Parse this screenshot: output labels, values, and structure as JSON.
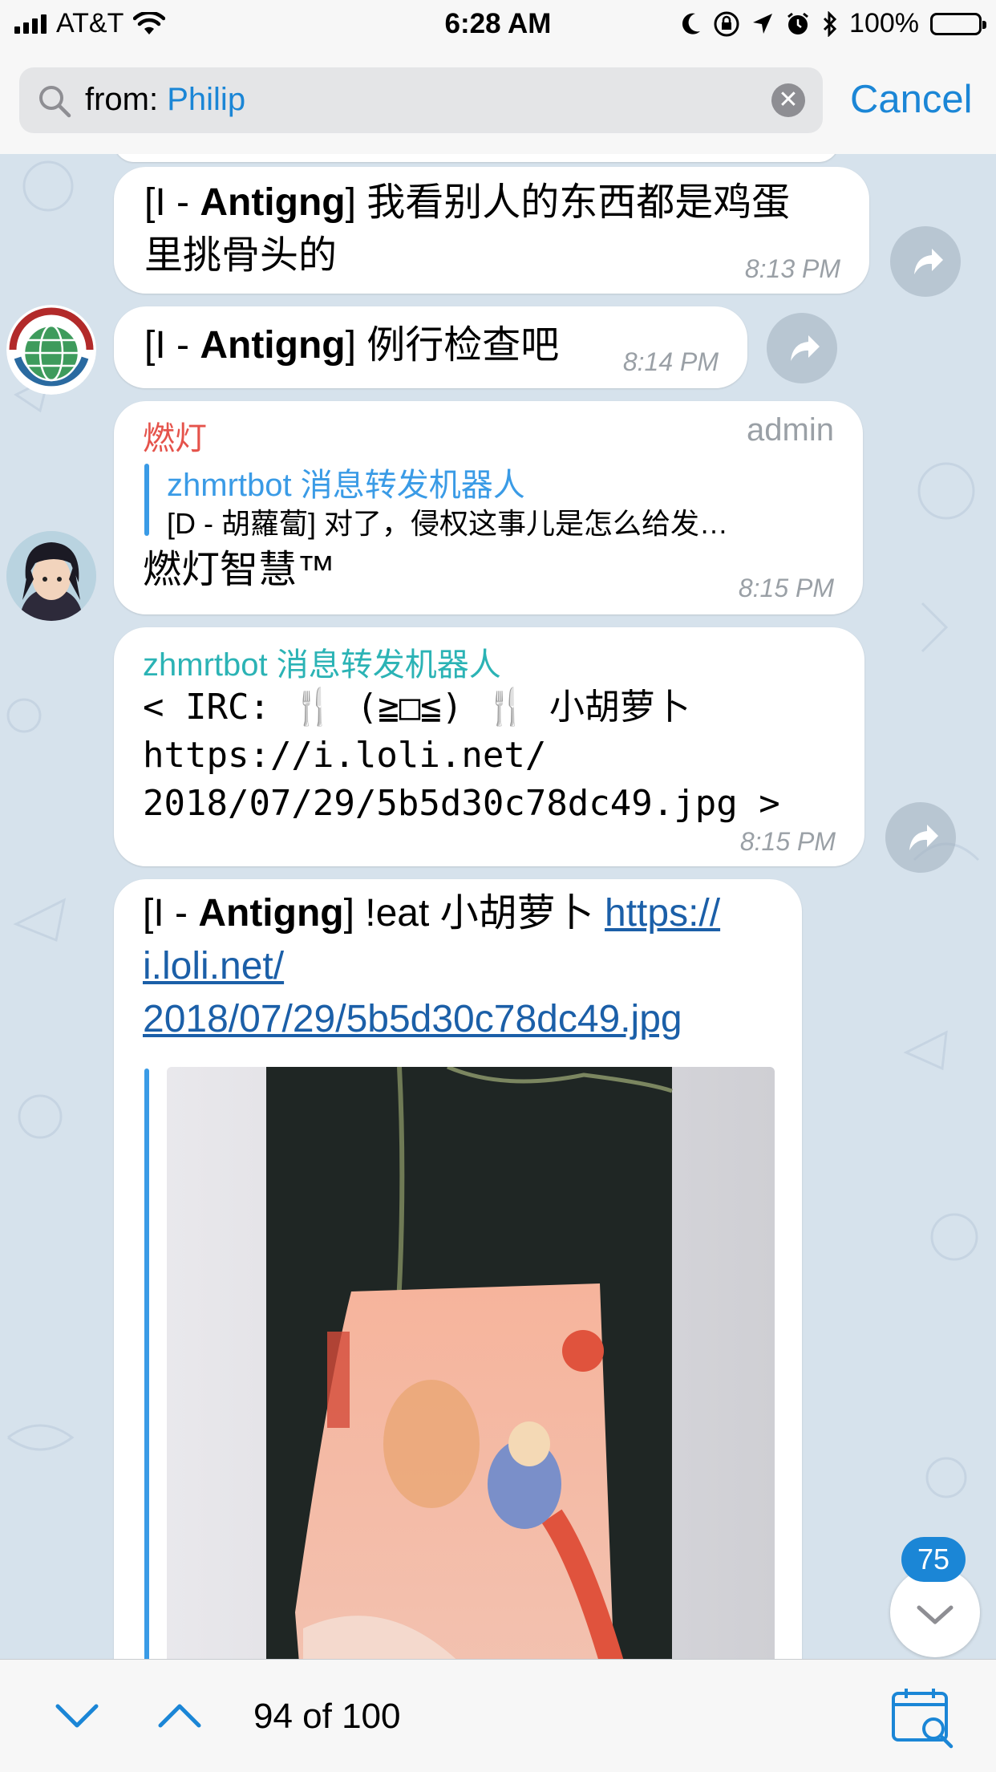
{
  "status_bar": {
    "carrier": "AT&T",
    "time": "6:28 AM",
    "battery": "100%"
  },
  "search": {
    "prefix": "from: ",
    "query": "Philip",
    "cancel_label": "Cancel"
  },
  "messages": [
    {
      "author_prefix": "[I - ",
      "author": "Antigng",
      "author_suffix": "] ",
      "text_line1": "我看别人的东西都是鸡蛋",
      "text_line2": "里挑骨头的",
      "time": "8:13 PM"
    },
    {
      "author_prefix": "[I - ",
      "author": "Antigng",
      "author_suffix": "] ",
      "text": "例行检查吧",
      "time": "8:14 PM"
    },
    {
      "sender": "燃灯",
      "role": "admin",
      "reply_name": "zhmrtbot 消息转发机器人",
      "reply_text": "[D - 胡蘿蔔] 对了，侵权这事儿是怎么给发…",
      "text": "燃灯智慧™",
      "time": "8:15 PM"
    },
    {
      "sender": "zhmrtbot 消息转发机器人",
      "line1": "< IRC: 🍴 (≧□≦) 🍴 小胡萝卜",
      "line2": "https://i.loli.net/",
      "line3": "2018/07/29/5b5d30c78dc49.jpg >",
      "time": "8:15 PM"
    },
    {
      "author_prefix": "[I - ",
      "author": "Antigng",
      "author_suffix": "] ",
      "text": "!eat 小胡萝卜 ",
      "link1": "https://",
      "link2": "i.loli.net/",
      "link3": "2018/07/29/5b5d30c78dc49.jpg"
    }
  ],
  "unread_badge": "75",
  "bottom": {
    "counter": "94 of 100"
  },
  "colors": {
    "accent": "#1b86d6",
    "admin_name": "#e5534b",
    "bot_name": "#2bb3b5",
    "reply_name": "#3a9be6"
  }
}
